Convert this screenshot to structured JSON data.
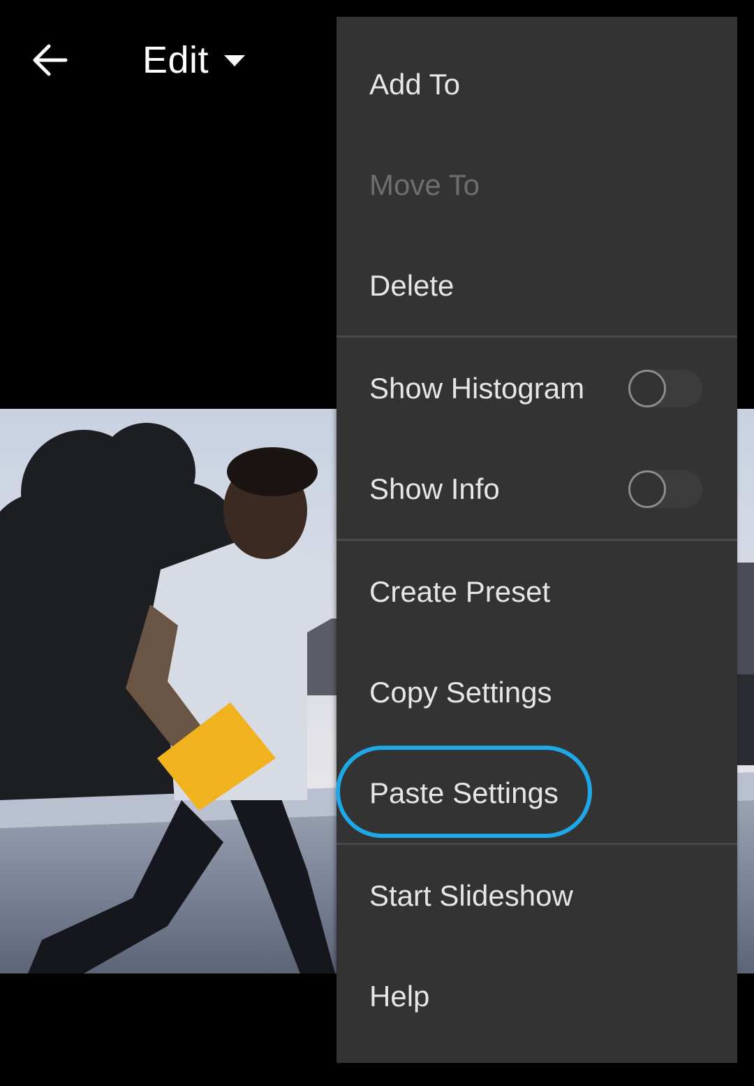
{
  "header": {
    "back_icon": "arrow-left-icon",
    "mode_label": "Edit",
    "mode_caret_icon": "caret-down-icon"
  },
  "photo": {
    "subject": "image"
  },
  "menu": {
    "items": [
      {
        "label": "Add To",
        "enabled": true
      },
      {
        "label": "Move To",
        "enabled": false
      },
      {
        "label": "Delete",
        "enabled": true
      },
      {
        "label": "Show Histogram",
        "enabled": true,
        "toggle": false
      },
      {
        "label": "Show Info",
        "enabled": true,
        "toggle": false
      },
      {
        "label": "Create Preset",
        "enabled": true
      },
      {
        "label": "Copy Settings",
        "enabled": true
      },
      {
        "label": "Paste Settings",
        "enabled": true,
        "highlighted": true
      },
      {
        "label": "Start Slideshow",
        "enabled": true
      },
      {
        "label": "Help",
        "enabled": true
      }
    ]
  },
  "colors": {
    "menu_background": "#333333",
    "highlight": "#1fa8e8",
    "text_primary": "#e6e6e6",
    "text_disabled": "#6e6e6e"
  }
}
